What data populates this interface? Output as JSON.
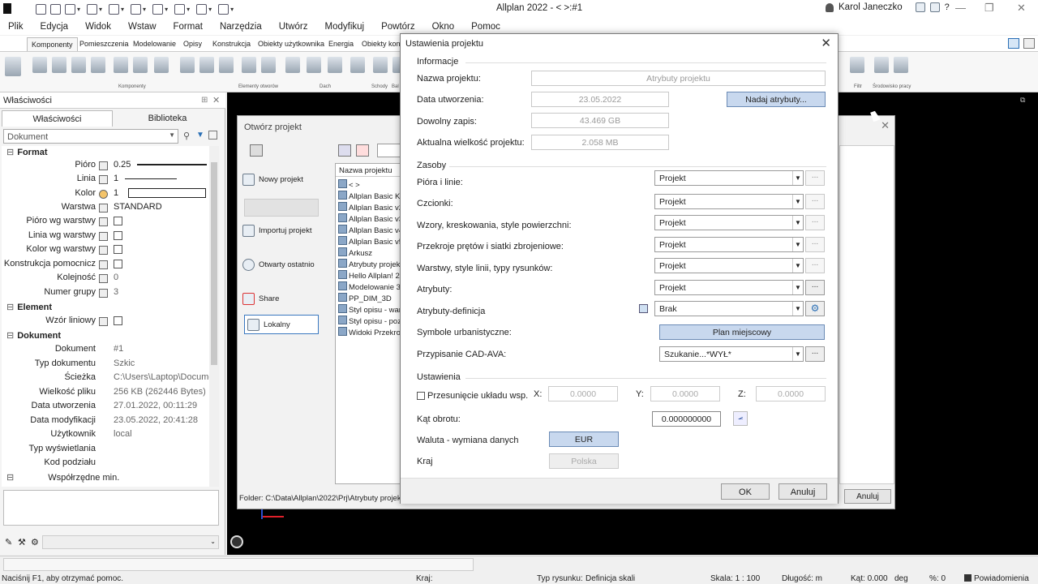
{
  "window": {
    "title": "Allplan 2022 - <    >:#1",
    "user": "Karol Janeczko"
  },
  "menu": [
    "Plik",
    "Edycja",
    "Widok",
    "Wstaw",
    "Format",
    "Narzędzia",
    "Utwórz",
    "Modyfikuj",
    "Powtórz",
    "Okno",
    "Pomoc"
  ],
  "ribbon": {
    "tabs": [
      "Komponenty",
      "Pomieszczenia",
      "Modelowanie",
      "Opisy",
      "Konstrukcja",
      "Obiekty użytkownika",
      "Energia",
      "Obiekty kons"
    ],
    "groups": [
      "Komponenty",
      "Elementy otworów",
      "Dach",
      "Schody",
      "Bal",
      "Filtr",
      "Środowisko pracy"
    ]
  },
  "left_panel": {
    "title": "Właściwości",
    "tabs": [
      "Właściwości",
      "Biblioteka"
    ],
    "dropdown": "Dokument",
    "sections": {
      "format": "Format",
      "element": "Element",
      "dokument": "Dokument",
      "wspolrzedne": "Współrzędne min."
    },
    "format_rows": [
      {
        "label": "Pióro",
        "value": "0.25"
      },
      {
        "label": "Linia",
        "value": "1"
      },
      {
        "label": "Kolor",
        "value": "1"
      },
      {
        "label": "Warstwa",
        "value": "STANDARD"
      },
      {
        "label": "Pióro wg warstwy",
        "value": ""
      },
      {
        "label": "Linia wg warstwy",
        "value": ""
      },
      {
        "label": "Kolor wg warstwy",
        "value": ""
      },
      {
        "label": "Konstrukcja pomocnicz",
        "value": ""
      },
      {
        "label": "Kolejność",
        "value": "0"
      },
      {
        "label": "Numer grupy",
        "value": "3"
      }
    ],
    "element_rows": [
      {
        "label": "Wzór liniowy",
        "value": ""
      }
    ],
    "dokument_rows": [
      {
        "label": "Dokument",
        "value": "#1"
      },
      {
        "label": "Typ dokumentu",
        "value": "Szkic"
      },
      {
        "label": "Ścieżka",
        "value": "C:\\Users\\Laptop\\Documer"
      },
      {
        "label": "Wielkość pliku",
        "value": "256 KB (262446 Bytes)"
      },
      {
        "label": "Data utworzenia",
        "value": "27.01.2022, 00:11:29"
      },
      {
        "label": "Data modyfikacji",
        "value": "23.05.2022, 20:41:28"
      },
      {
        "label": "Użytkownik",
        "value": "local"
      },
      {
        "label": "Typ wyświetlania",
        "value": ""
      },
      {
        "label": "Kod podziału",
        "value": ""
      }
    ]
  },
  "open_dialog": {
    "title": "Otwórz projekt",
    "nav": [
      "Nowy projekt",
      "Importuj projekt",
      "Otwarty ostatnio",
      "Share",
      "Lokalny"
    ],
    "list_header": "Nazwa projektu",
    "files": [
      "<    >",
      "Allplan Basic Ku",
      "Allplan Basic v2",
      "Allplan Basic v3",
      "Allplan Basic v4",
      "Allplan Basic v5",
      "Arkusz",
      "Atrybuty projekt",
      "Hello Allplan! 20",
      "Modelowanie 3D",
      "PP_DIM_3D",
      "Styl opisu - wars",
      "Styl opisu - pozic",
      "Widoki Przekroj"
    ],
    "folder": "Folder: C:\\Data\\Allplan\\2022\\Prj\\Atrybuty projektu.prj",
    "cancel": "Anuluj"
  },
  "settings_dialog": {
    "title": "Ustawienia projektu",
    "info": {
      "group": "Informacje",
      "name_label": "Nazwa projektu:",
      "name_value": "Atrybuty projektu",
      "created_label": "Data utworzenia:",
      "created_value": "23.05.2022",
      "free_label": "Dowolny zapis:",
      "free_value": "43.469 GB",
      "size_label": "Aktualna wielkość projektu:",
      "size_value": "2.058 MB",
      "assign_button": "Nadaj atrybuty..."
    },
    "resources": {
      "group": "Zasoby",
      "rows": [
        {
          "label": "Pióra i linie:",
          "value": "Projekt"
        },
        {
          "label": "Czcionki:",
          "value": "Projekt"
        },
        {
          "label": "Wzory, kreskowania, style powierzchni:",
          "value": "Projekt"
        },
        {
          "label": "Przekroje prętów i siatki zbrojeniowe:",
          "value": "Projekt"
        },
        {
          "label": "Warstwy, style linii, typy rysunków:",
          "value": "Projekt"
        },
        {
          "label": "Atrybuty:",
          "value": "Projekt"
        },
        {
          "label": "Atrybuty-definicja",
          "value": "Brak"
        }
      ],
      "urban_label": "Symbole urbanistyczne:",
      "urban_button": "Plan miejscowy",
      "cad_label": "Przypisanie CAD-AVA:",
      "cad_value": "Szukanie...*WYŁ*"
    },
    "settings": {
      "group": "Ustawienia",
      "offset_label": "Przesunięcie układu wsp.",
      "x_label": "X:",
      "x_value": "0.0000",
      "y_label": "Y:",
      "y_value": "0.0000",
      "z_label": "Z:",
      "z_value": "0.0000",
      "angle_label": "Kąt obrotu:",
      "angle_value": "0.000000000",
      "currency_label": "Waluta - wymiana danych",
      "currency_value": "EUR",
      "country_label": "Kraj",
      "country_value": "Polska"
    },
    "ok": "OK",
    "cancel": "Anuluj"
  },
  "status": {
    "help": "Naciśnij F1, aby otrzymać pomoc.",
    "kraj": "Kraj:",
    "drawing_type_label": "Typ rysunku:",
    "drawing_type_value": "Definicja skali",
    "scale": "Skala: 1 : 100",
    "length": "Długość: m",
    "angle": "Kąt: 0.000",
    "unit": "deg",
    "percent": "%: 0",
    "notifications": "Powiadomienia"
  }
}
